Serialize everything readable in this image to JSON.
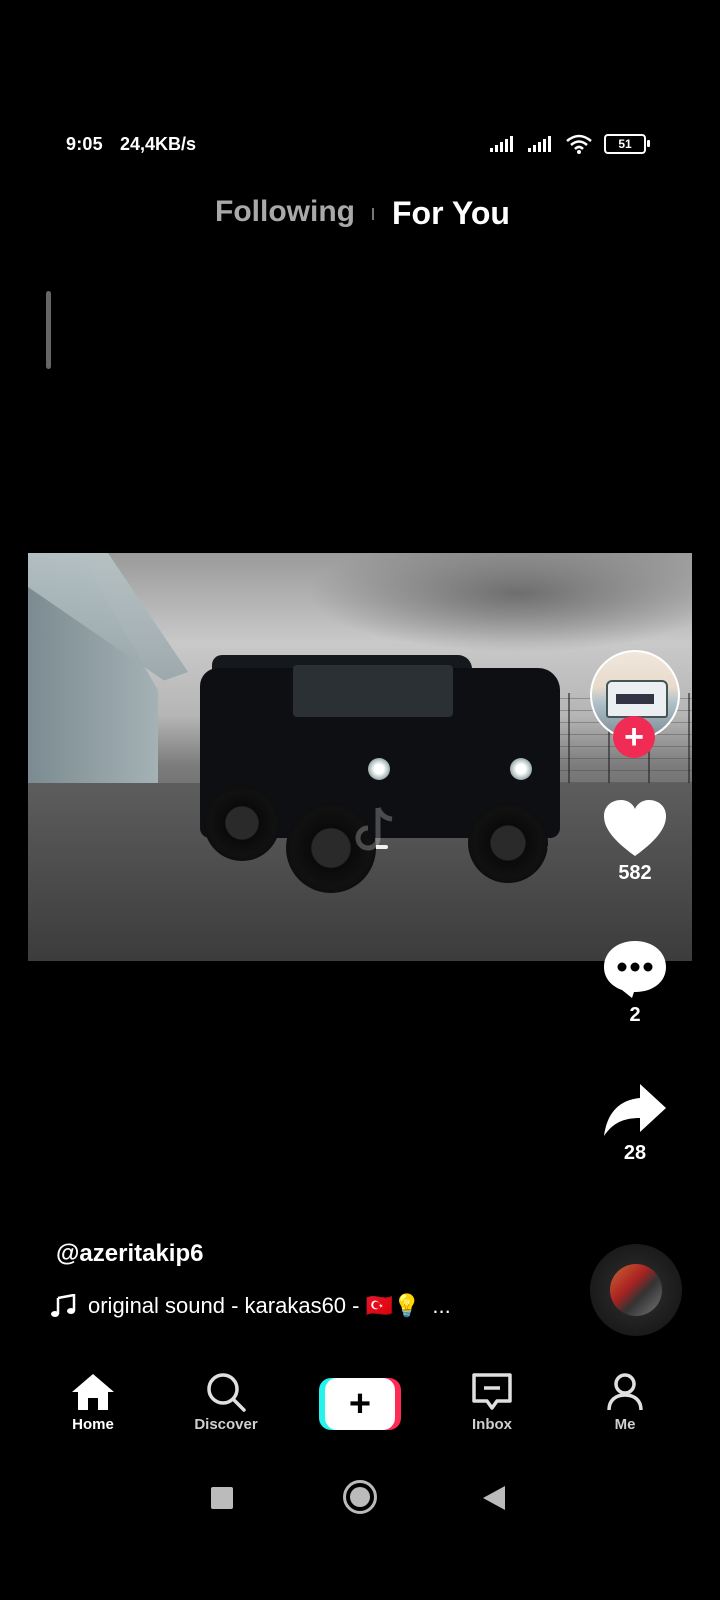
{
  "status_bar": {
    "time": "9:05",
    "net_speed": "24,4KB/s",
    "battery": "51",
    "icons": [
      "signal-icon",
      "signal-icon",
      "wifi-icon",
      "battery-icon"
    ]
  },
  "feed_tabs": {
    "following": "Following",
    "for_you": "For You",
    "active": "For You"
  },
  "video": {
    "watermark_icon": "tiktok-logo-icon"
  },
  "actions": {
    "likes": "582",
    "comments": "2",
    "shares": "28"
  },
  "caption": {
    "username": "@azeritakip6",
    "sound": "original sound - karakas60 - 🇹🇷💡",
    "sound_ellipsis": "..."
  },
  "bottom_nav": {
    "home": "Home",
    "discover": "Discover",
    "inbox": "Inbox",
    "me": "Me",
    "active": "Home"
  },
  "colors": {
    "accent_red": "#fe2c55",
    "accent_cyan": "#25f4ee",
    "background": "#000000"
  }
}
